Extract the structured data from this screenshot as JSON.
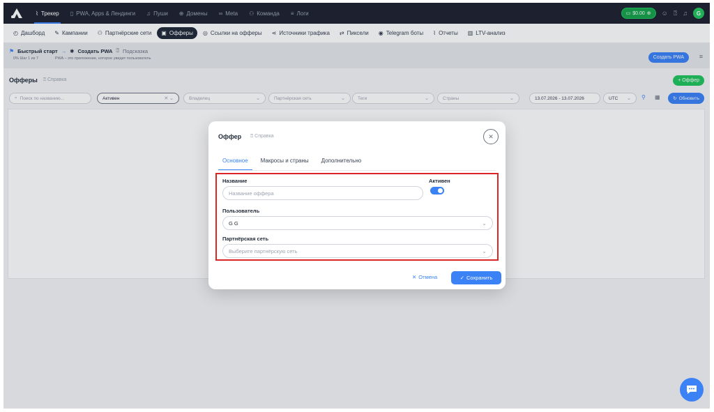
{
  "topnav": {
    "items": [
      {
        "icon": "chart-line-icon",
        "glyph": "⌇",
        "label": "Трекер",
        "active": true
      },
      {
        "icon": "phone-icon",
        "glyph": "▯",
        "label": "PWA, Apps & Лендинги"
      },
      {
        "icon": "bell-icon",
        "glyph": "♫",
        "label": "Пуши"
      },
      {
        "icon": "globe-icon",
        "glyph": "⊕",
        "label": "Домены"
      },
      {
        "icon": "meta-icon",
        "glyph": "∞",
        "label": "Meta"
      },
      {
        "icon": "team-icon",
        "glyph": "⚇",
        "label": "Команда"
      },
      {
        "icon": "list-icon",
        "glyph": "≡",
        "label": "Логи"
      }
    ],
    "balance": "$0.00",
    "avatar_letter": "G"
  },
  "subnav": {
    "items": [
      {
        "icon": "dashboard-icon",
        "glyph": "◴",
        "label": "Дашборд"
      },
      {
        "icon": "edit-icon",
        "glyph": "✎",
        "label": "Кампании"
      },
      {
        "icon": "partners-icon",
        "glyph": "⚇",
        "label": "Партнёрские сети"
      },
      {
        "icon": "gift-icon",
        "glyph": "▣",
        "label": "Офферы",
        "active": true
      },
      {
        "icon": "location-icon",
        "glyph": "◎",
        "label": "Ссылки на офферы"
      },
      {
        "icon": "share-icon",
        "glyph": "⋖",
        "label": "Источники трафика"
      },
      {
        "icon": "swap-icon",
        "glyph": "⇄",
        "label": "Пиксели"
      },
      {
        "icon": "telegram-icon",
        "glyph": "◉",
        "label": "Telegram боты"
      },
      {
        "icon": "report-icon",
        "glyph": "⌇",
        "label": "Отчеты"
      },
      {
        "icon": "bar-chart-icon",
        "glyph": "▥",
        "label": "LTV-анализ"
      }
    ]
  },
  "quick_start": {
    "title": "Быстрый старт",
    "step": "Создать PWA",
    "hint": "Подсказка",
    "progress": "0%  Шаг 1 из 7",
    "description": "PWA – это приложение, которое увидит пользователь",
    "create_pwa": "Создать PWA"
  },
  "offers": {
    "title": "Офферы",
    "help": "Справка",
    "add_button": "+ Оффер"
  },
  "filters": {
    "search_placeholder": "Поиск по названию...",
    "status": "Активен",
    "owner": "Владелец",
    "network": "Партнёрская сеть",
    "tags": "Теги",
    "countries": "Страны",
    "date_range": "13.07.2026 - 13.07.2026",
    "timezone": "UTC",
    "refresh": "Обновить"
  },
  "modal": {
    "title": "Оффер",
    "help": "Справка",
    "tabs": [
      "Основное",
      "Макросы и страны",
      "Дополнительно"
    ],
    "name_label": "Название",
    "name_placeholder": "Название оффера",
    "active_label": "Активен",
    "active": true,
    "user_label": "Пользователь",
    "user_value": "G G",
    "network_label": "Партнёрская сеть",
    "network_placeholder": "Выберите партнёрскую сеть",
    "cancel": "Отмена",
    "save": "Сохранить"
  },
  "colors": {
    "accent": "#3b82f6",
    "topbar": "#1f2330",
    "success": "#22c55e",
    "highlight": "#dc2626"
  }
}
